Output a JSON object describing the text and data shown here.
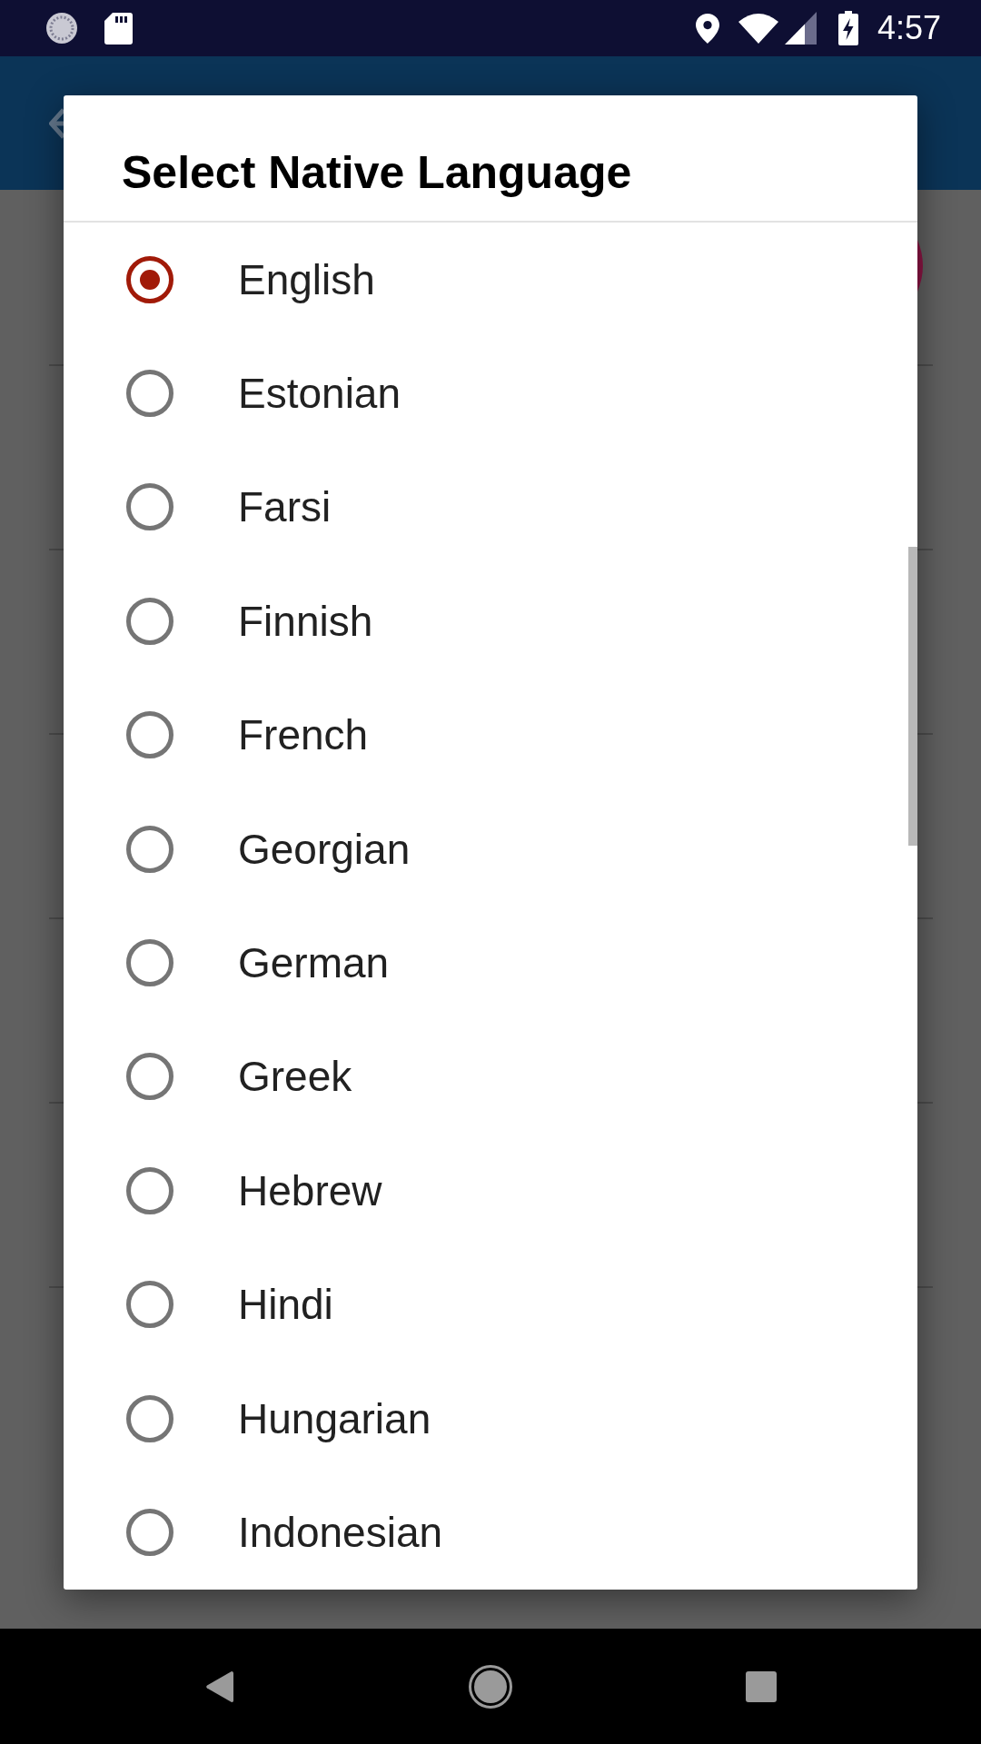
{
  "status_bar": {
    "time": "4:57"
  },
  "dialog": {
    "title": "Select Native Language",
    "options": [
      {
        "label": "English",
        "selected": true
      },
      {
        "label": "Estonian",
        "selected": false
      },
      {
        "label": "Farsi",
        "selected": false
      },
      {
        "label": "Finnish",
        "selected": false
      },
      {
        "label": "French",
        "selected": false
      },
      {
        "label": "Georgian",
        "selected": false
      },
      {
        "label": "German",
        "selected": false
      },
      {
        "label": "Greek",
        "selected": false
      },
      {
        "label": "Hebrew",
        "selected": false
      },
      {
        "label": "Hindi",
        "selected": false
      },
      {
        "label": "Hungarian",
        "selected": false
      },
      {
        "label": "Indonesian",
        "selected": false
      }
    ]
  }
}
